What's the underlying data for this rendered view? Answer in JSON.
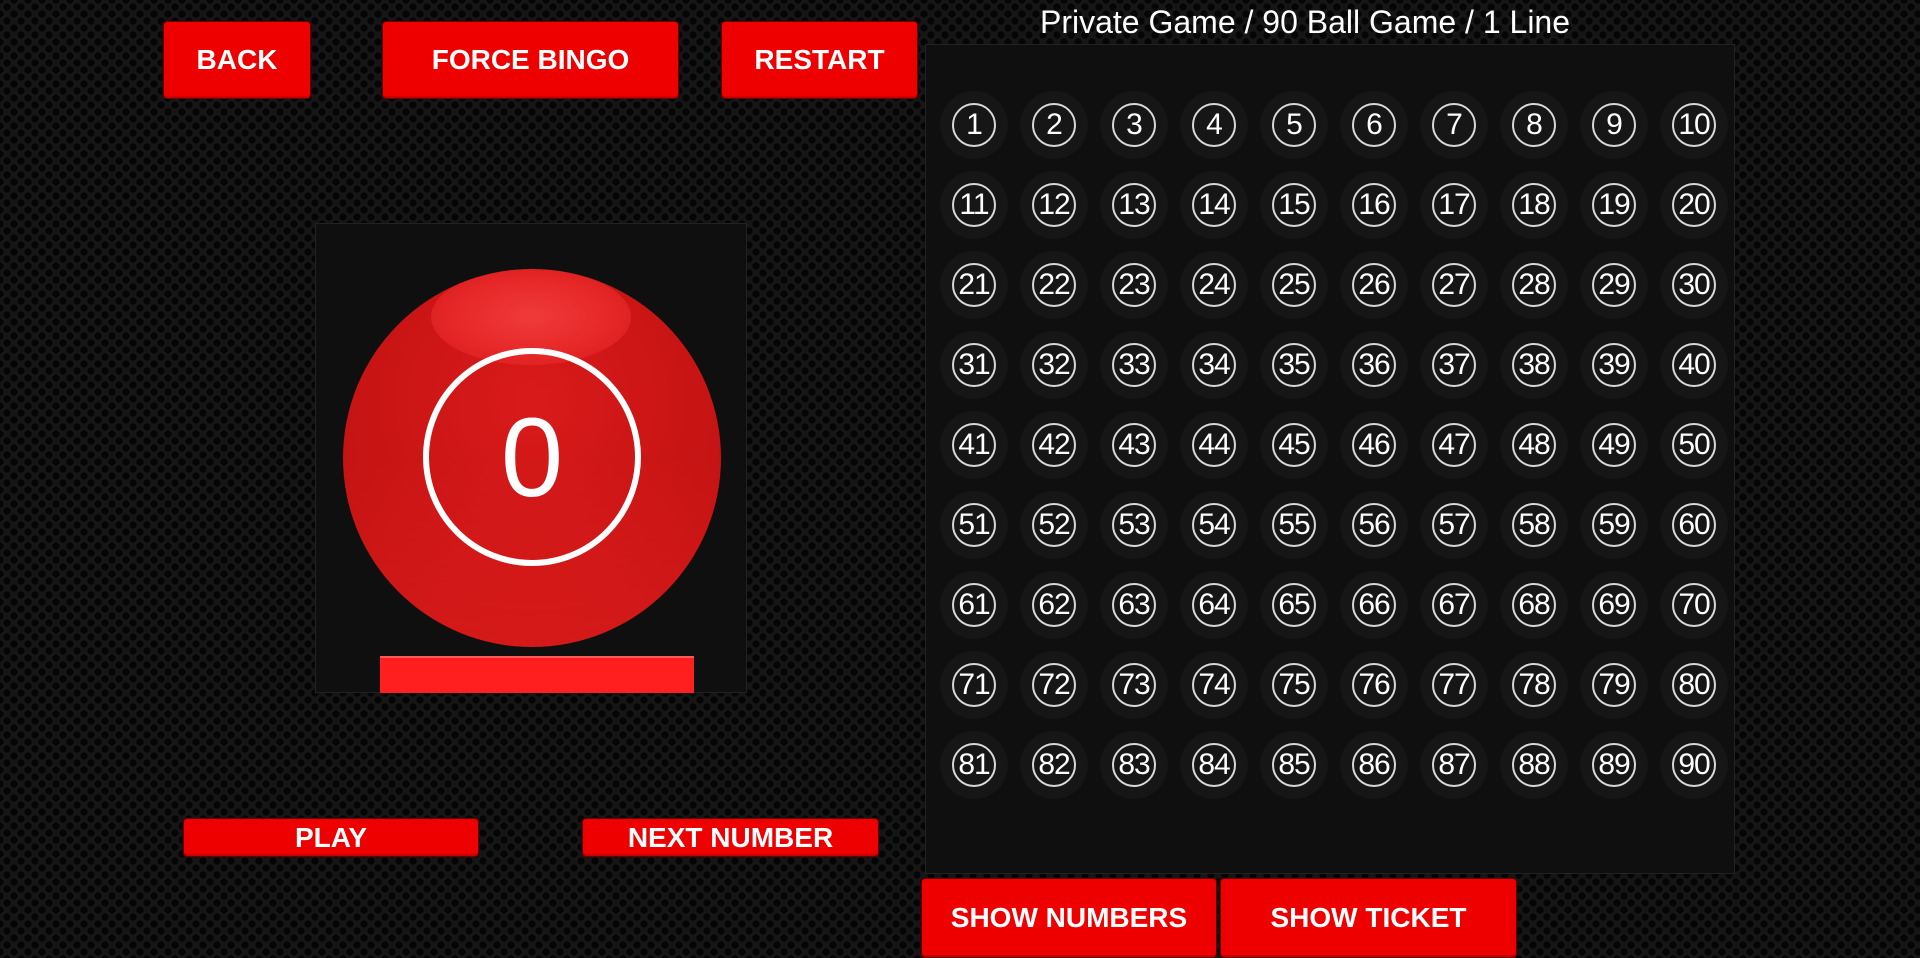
{
  "top_buttons": {
    "back": "BACK",
    "force_bingo": "FORCE BINGO",
    "restart": "RESTART"
  },
  "ball": {
    "current_number": "0"
  },
  "controls": {
    "play": "PLAY",
    "next_number": "NEXT NUMBER"
  },
  "board": {
    "title": "Private Game / 90 Ball Game / 1 Line",
    "numbers": [
      "1",
      "2",
      "3",
      "4",
      "5",
      "6",
      "7",
      "8",
      "9",
      "10",
      "11",
      "12",
      "13",
      "14",
      "15",
      "16",
      "17",
      "18",
      "19",
      "20",
      "21",
      "22",
      "23",
      "24",
      "25",
      "26",
      "27",
      "28",
      "29",
      "30",
      "31",
      "32",
      "33",
      "34",
      "35",
      "36",
      "37",
      "38",
      "39",
      "40",
      "41",
      "42",
      "43",
      "44",
      "45",
      "46",
      "47",
      "48",
      "49",
      "50",
      "51",
      "52",
      "53",
      "54",
      "55",
      "56",
      "57",
      "58",
      "59",
      "60",
      "61",
      "62",
      "63",
      "64",
      "65",
      "66",
      "67",
      "68",
      "69",
      "70",
      "71",
      "72",
      "73",
      "74",
      "75",
      "76",
      "77",
      "78",
      "79",
      "80",
      "81",
      "82",
      "83",
      "84",
      "85",
      "86",
      "87",
      "88",
      "89",
      "90"
    ]
  },
  "bottom_buttons": {
    "show_numbers": "SHOW NUMBERS",
    "show_ticket": "SHOW TICKET"
  },
  "colors": {
    "accent_red": "#ee0000",
    "ball_red": "#c81414",
    "panel_bg": "#0f0f0f"
  }
}
